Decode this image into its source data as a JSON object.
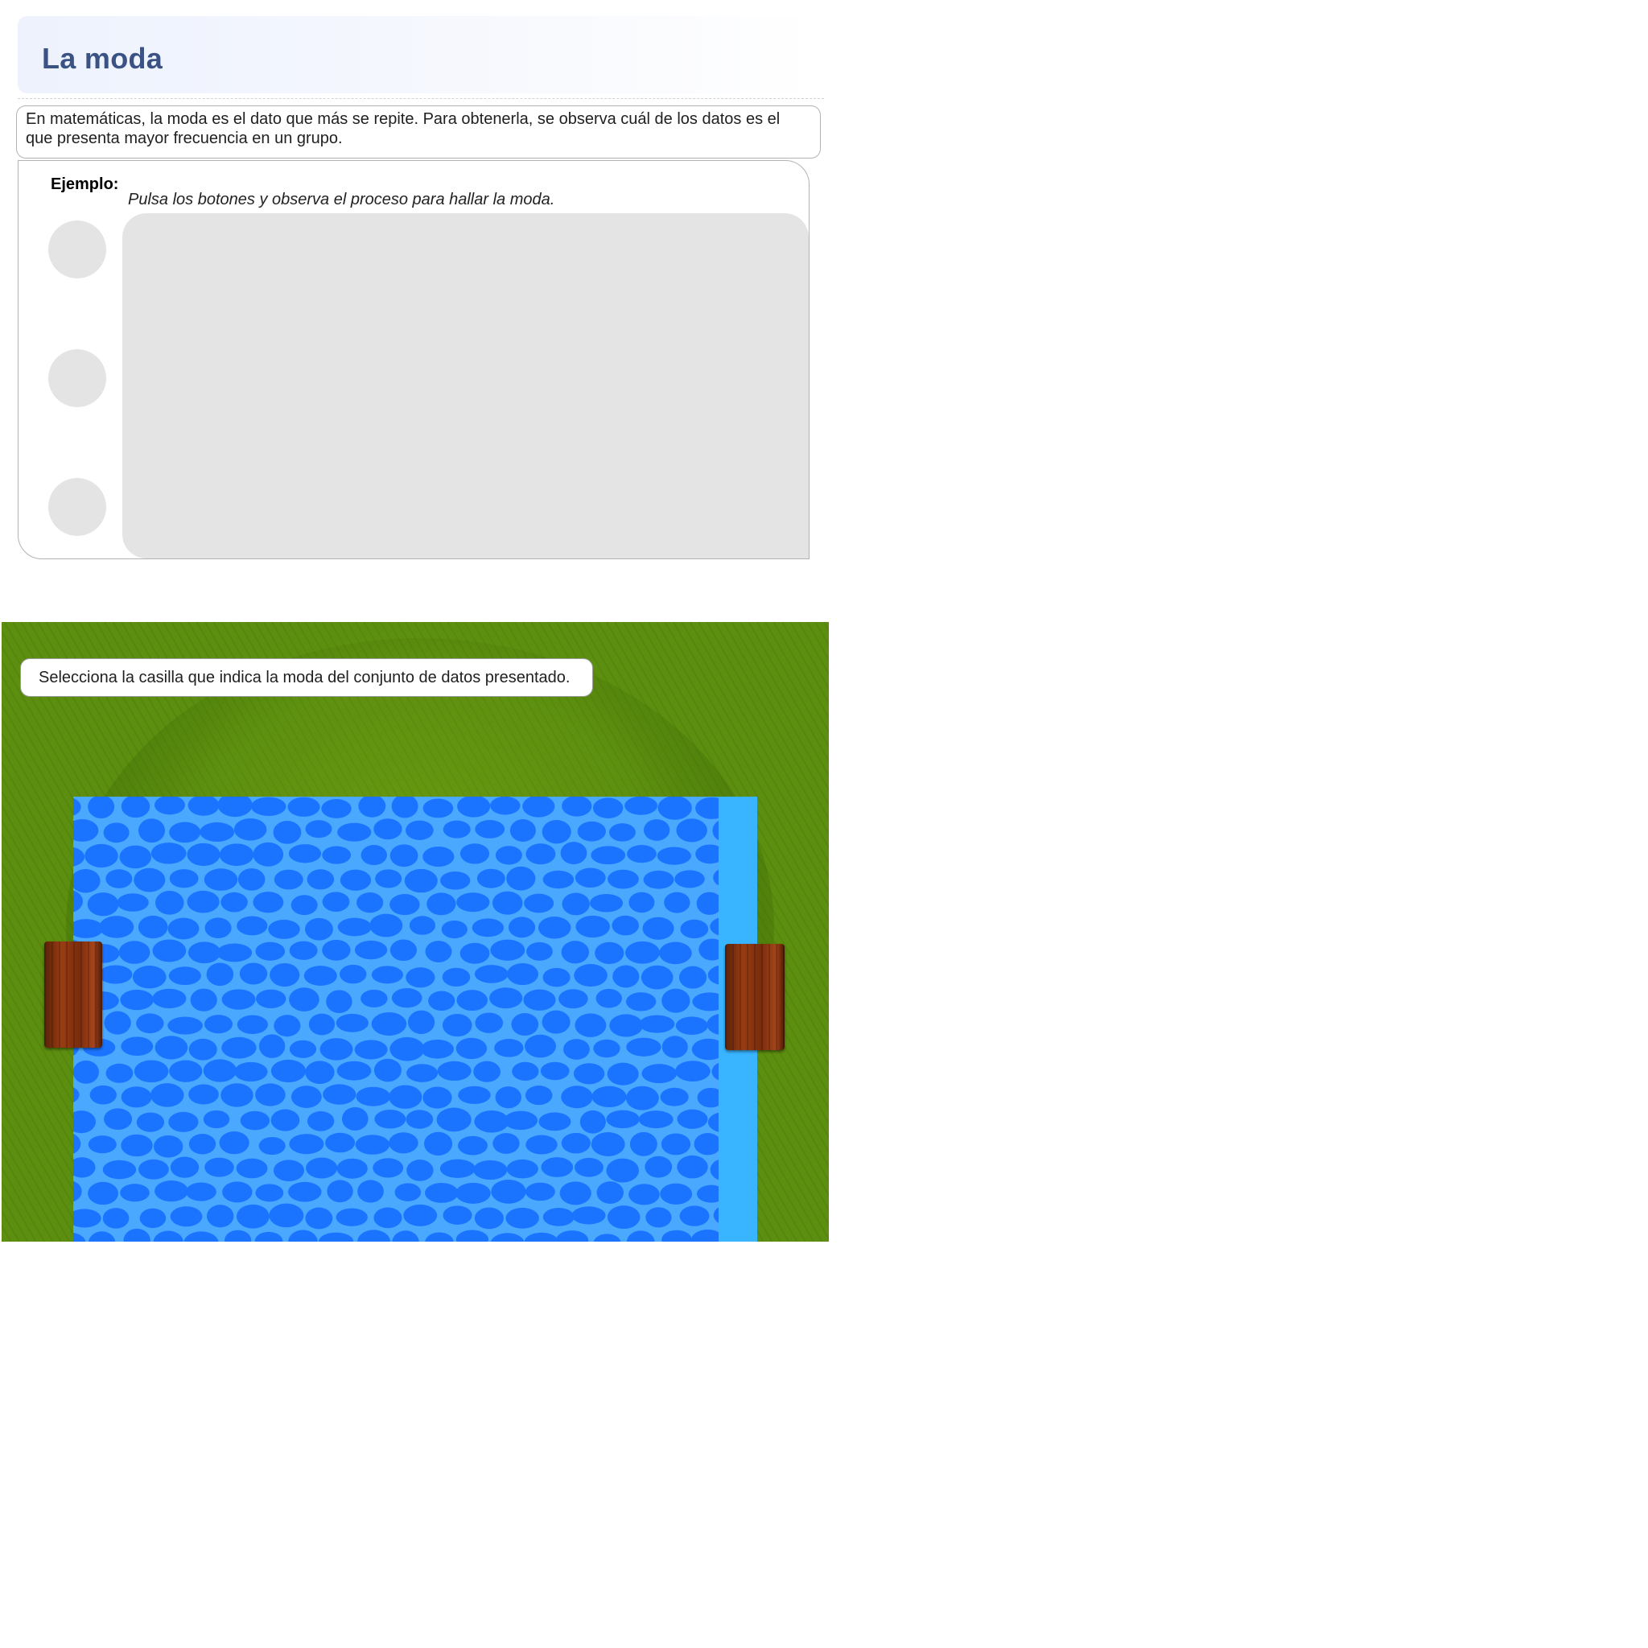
{
  "header": {
    "title": "La moda"
  },
  "definition": {
    "line1": "En matemáticas, la moda es el dato que más se repite. Para obtenerla, se observa cuál de los datos es el",
    "line2": "que presenta mayor frecuencia en un grupo."
  },
  "example": {
    "label": "Ejemplo:",
    "hint": "Pulsa los botones y observa el proceso para hallar la moda."
  },
  "game": {
    "instruction": "Selecciona la casilla que indica la moda del conjunto de datos presentado.",
    "colors": {
      "grass": "#5c8e0f",
      "water": "#1a74ff",
      "water_light": "#39b4ff",
      "log": "#8a3410"
    }
  }
}
